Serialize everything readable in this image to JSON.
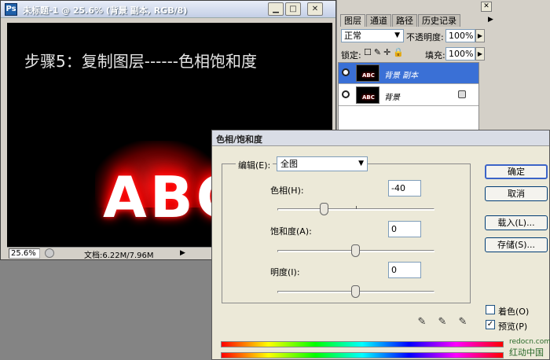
{
  "document": {
    "title": "未标题-1 @ 25.6% (背景 副本, RGB/8)",
    "app_icon": "photoshop-doc-icon",
    "canvas_text": "步骤5：复制图层------色相饱和度",
    "art_text": "ABC",
    "status": {
      "zoom": "25.6%",
      "doc_size": "文档:6.22M/7.96M"
    }
  },
  "layers_panel": {
    "tabs": [
      "图层",
      "通道",
      "路径",
      "历史记录"
    ],
    "blend_mode": "正常",
    "opacity_label": "不透明度:",
    "opacity": "100%",
    "lock_label": "锁定:",
    "fill_label": "填充:",
    "fill": "100%",
    "layers": [
      {
        "name": "背景 副本",
        "selected": true
      },
      {
        "name": "背景",
        "selected": false
      }
    ]
  },
  "hue_sat_dialog": {
    "title": "色相/饱和度",
    "edit_label": "编辑(E):",
    "edit_value": "全图",
    "hue_label": "色相(H):",
    "hue_value": "-40",
    "saturation_label": "饱和度(A):",
    "saturation_value": "0",
    "lightness_label": "明度(I):",
    "lightness_value": "0",
    "buttons": {
      "ok": "确定",
      "cancel": "取消",
      "load": "载入(L)...",
      "save": "存储(S)..."
    },
    "colorize_label": "着色(O)",
    "colorize_checked": false,
    "preview_label": "预览(P)",
    "preview_checked": true
  },
  "watermark": {
    "line1": "redocn.com",
    "line2": "红动中国"
  },
  "colors": {
    "selected_layer": "#3a70d6",
    "dialog_bg": "#ece9d8"
  }
}
